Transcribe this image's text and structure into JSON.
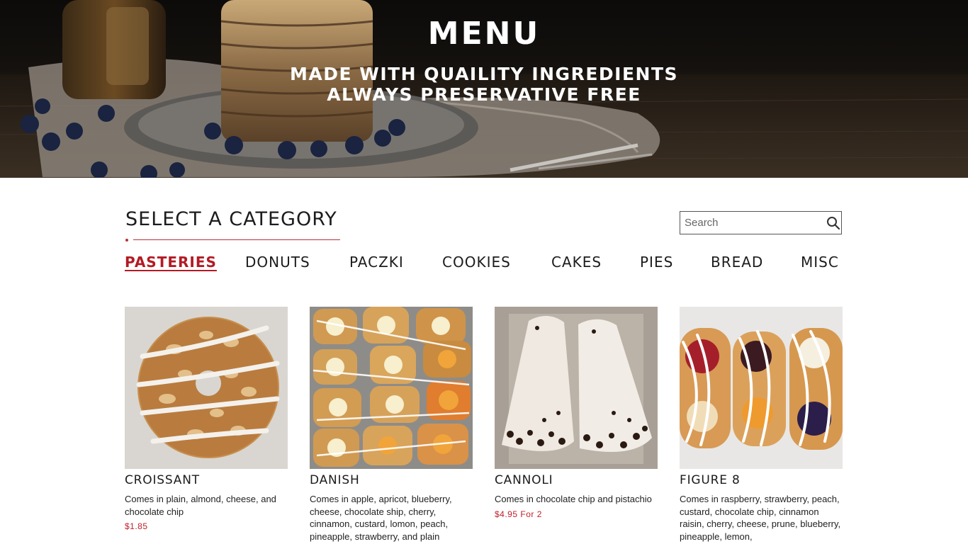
{
  "hero": {
    "title": "MENU",
    "subtitle_line1": "MADE WITH QUAILITY INGREDIENTS",
    "subtitle_line2": "ALWAYS PRESERVATIVE FREE"
  },
  "category_section": {
    "heading": "SELECT A CATEGORY",
    "search": {
      "placeholder": "Search",
      "value": ""
    }
  },
  "categories": [
    {
      "label": "PASTERIES",
      "active": true
    },
    {
      "label": "DONUTS",
      "active": false
    },
    {
      "label": "PACZKI",
      "active": false
    },
    {
      "label": "COOKIES",
      "active": false
    },
    {
      "label": "CAKES",
      "active": false
    },
    {
      "label": "PIES",
      "active": false
    },
    {
      "label": "BREAD",
      "active": false
    },
    {
      "label": "MISC",
      "active": false
    }
  ],
  "products": [
    {
      "name": "CROISSANT",
      "description": "Comes in plain, almond, cheese, and chocolate chip",
      "price": "$1.85"
    },
    {
      "name": "DANISH",
      "description": "Comes in apple, apricot, blueberry, cheese, chocolate ship, cherry, cinnamon, custard, lomon, peach, pineapple, strawberry, and plain",
      "price": ""
    },
    {
      "name": "CANNOLI",
      "description": "Comes in chocolate chip and pistachio",
      "price": "$4.95  For 2"
    },
    {
      "name": "FIGURE 8",
      "description": "Comes in raspberry, strawberry, peach, custard, chocolate chip, cinnamon raisin, cherry, cheese, prune, blueberry, pineapple, lemon,",
      "price": ""
    }
  ],
  "colors": {
    "accent_red": "#b31b24",
    "price_red": "#c0202c",
    "text_dark": "#1c1c1c",
    "hero_dark": "#0c0b0a"
  },
  "icons": {
    "search": "search-icon"
  }
}
